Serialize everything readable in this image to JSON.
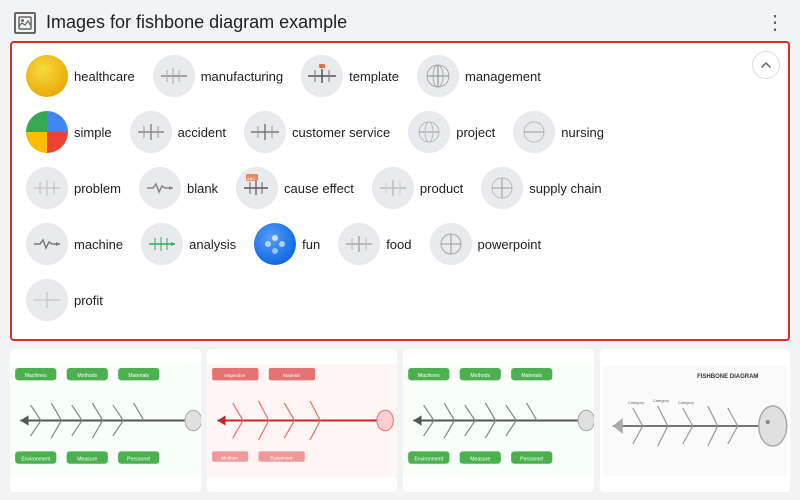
{
  "header": {
    "title": "Images for fishbone diagram example",
    "menu_icon": "⋮",
    "image_icon": "🖼"
  },
  "tags": {
    "rows": [
      [
        {
          "id": "healthcare",
          "label": "healthcare",
          "thumb": "yellow"
        },
        {
          "id": "manufacturing",
          "label": "manufacturing",
          "thumb": "gray"
        },
        {
          "id": "template",
          "label": "template",
          "thumb": "gray"
        },
        {
          "id": "management",
          "label": "management",
          "thumb": "gray"
        }
      ],
      [
        {
          "id": "simple",
          "label": "simple",
          "thumb": "pie"
        },
        {
          "id": "accident",
          "label": "accident",
          "thumb": "gray"
        },
        {
          "id": "customer-service",
          "label": "customer service",
          "thumb": "gray"
        },
        {
          "id": "project",
          "label": "project",
          "thumb": "gray"
        },
        {
          "id": "nursing",
          "label": "nursing",
          "thumb": "gray"
        }
      ],
      [
        {
          "id": "problem",
          "label": "problem",
          "thumb": "gray"
        },
        {
          "id": "blank",
          "label": "blank",
          "thumb": "gray"
        },
        {
          "id": "cause-effect",
          "label": "cause effect",
          "thumb": "gray"
        },
        {
          "id": "product",
          "label": "product",
          "thumb": "gray"
        },
        {
          "id": "supply-chain",
          "label": "supply chain",
          "thumb": "gray"
        }
      ],
      [
        {
          "id": "machine",
          "label": "machine",
          "thumb": "gray"
        },
        {
          "id": "analysis",
          "label": "analysis",
          "thumb": "gray"
        },
        {
          "id": "fun",
          "label": "fun",
          "thumb": "blue"
        },
        {
          "id": "food",
          "label": "food",
          "thumb": "gray"
        },
        {
          "id": "powerpoint",
          "label": "powerpoint",
          "thumb": "gray"
        }
      ],
      [
        {
          "id": "profit",
          "label": "profit",
          "thumb": "gray"
        }
      ]
    ],
    "collapse_label": "▲"
  },
  "bottom_images": [
    {
      "id": "diagram-1",
      "type": "fishbone-green"
    },
    {
      "id": "diagram-2",
      "type": "fishbone-red"
    },
    {
      "id": "diagram-3",
      "type": "fishbone-green2"
    },
    {
      "id": "diagram-4",
      "type": "fishbone-white"
    }
  ]
}
